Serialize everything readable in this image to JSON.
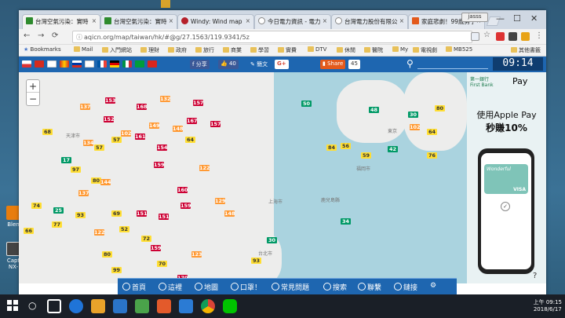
{
  "desktop": {
    "icons": [
      {
        "label": "Blen"
      },
      {
        "label": "Capt NX-"
      }
    ]
  },
  "browser": {
    "tabs": [
      {
        "label": "台灣空氣污染：實時",
        "color": "#2e8b2e"
      },
      {
        "label": "台灣空氣污染：實時",
        "color": "#2e8b2e"
      },
      {
        "label": "Windy: Wind map",
        "color": "#b5202a"
      },
      {
        "label": "今日電力資訊 - 電力",
        "color": "#888"
      },
      {
        "label": "台灣電力股份有限公",
        "color": "#888"
      },
      {
        "label": "家庭悲劇！99歲男子",
        "color": "#e35a1c"
      }
    ],
    "user_label": "jasss",
    "url": "aqicn.org/map/taiwan/hk/#@g/27.1563/119.9341/5z",
    "bookmarks": [
      "Bookmarks",
      "Mail",
      "入門網站",
      "理財",
      "政府",
      "旅行",
      "商業",
      "學習",
      "實費",
      "DTV",
      "休閒",
      "醫院",
      "My",
      "電視劇",
      "MB525"
    ],
    "other_bookmarks": "其他書籤"
  },
  "site": {
    "share_label": "分享",
    "like_count": "40",
    "chinese_label": "簡文",
    "gplus_label": "G+",
    "share_button": "Share",
    "share_count": "45",
    "time": "09:14"
  },
  "map": {
    "markers": [
      {
        "v": "137",
        "c": "#ff9933"
      },
      {
        "v": "153",
        "c": "#cc0033"
      },
      {
        "v": "168",
        "c": "#cc0033"
      },
      {
        "v": "132",
        "c": "#ff9933"
      },
      {
        "v": "157",
        "c": "#cc0033"
      },
      {
        "v": "68",
        "c": "#ffde33"
      },
      {
        "v": "134",
        "c": "#ff9933"
      },
      {
        "v": "152",
        "c": "#cc0033"
      },
      {
        "v": "149",
        "c": "#ff9933"
      },
      {
        "v": "148",
        "c": "#ff9933"
      },
      {
        "v": "57",
        "c": "#ffde33"
      },
      {
        "v": "102",
        "c": "#ff9933"
      },
      {
        "v": "161",
        "c": "#cc0033"
      },
      {
        "v": "154",
        "c": "#cc0033"
      },
      {
        "v": "64",
        "c": "#ffde33"
      },
      {
        "v": "57",
        "c": "#ffde33"
      },
      {
        "v": "167",
        "c": "#cc0033"
      },
      {
        "v": "157",
        "c": "#cc0033"
      },
      {
        "v": "17",
        "c": "#009966"
      },
      {
        "v": "97",
        "c": "#ffde33"
      },
      {
        "v": "80",
        "c": "#ffde33"
      },
      {
        "v": "137",
        "c": "#ff9933"
      },
      {
        "v": "159",
        "c": "#cc0033"
      },
      {
        "v": "144",
        "c": "#ff9933"
      },
      {
        "v": "160",
        "c": "#cc0033"
      },
      {
        "v": "122",
        "c": "#ff9933"
      },
      {
        "v": "74",
        "c": "#ffde33"
      },
      {
        "v": "25",
        "c": "#009966"
      },
      {
        "v": "93",
        "c": "#ffde33"
      },
      {
        "v": "151",
        "c": "#cc0033"
      },
      {
        "v": "69",
        "c": "#ffde33"
      },
      {
        "v": "151",
        "c": "#cc0033"
      },
      {
        "v": "159",
        "c": "#cc0033"
      },
      {
        "v": "129",
        "c": "#ff9933"
      },
      {
        "v": "148",
        "c": "#ff9933"
      },
      {
        "v": "66",
        "c": "#ffde33"
      },
      {
        "v": "77",
        "c": "#ffde33"
      },
      {
        "v": "122",
        "c": "#ff9933"
      },
      {
        "v": "52",
        "c": "#ffde33"
      },
      {
        "v": "72",
        "c": "#ffde33"
      },
      {
        "v": "159",
        "c": "#cc0033"
      },
      {
        "v": "80",
        "c": "#ffde33"
      },
      {
        "v": "70",
        "c": "#ffde33"
      },
      {
        "v": "123",
        "c": "#ff9933"
      },
      {
        "v": "99",
        "c": "#ffde33"
      },
      {
        "v": "170",
        "c": "#cc0033"
      },
      {
        "v": "50",
        "c": "#009966"
      },
      {
        "v": "84",
        "c": "#ffde33"
      },
      {
        "v": "48",
        "c": "#009966"
      },
      {
        "v": "30",
        "c": "#009966"
      },
      {
        "v": "56",
        "c": "#ffde33"
      },
      {
        "v": "102",
        "c": "#ff9933"
      },
      {
        "v": "59",
        "c": "#ffde33"
      },
      {
        "v": "42",
        "c": "#009966"
      },
      {
        "v": "64",
        "c": "#ffde33"
      },
      {
        "v": "76",
        "c": "#ffde33"
      },
      {
        "v": "80",
        "c": "#ffde33"
      },
      {
        "v": "34",
        "c": "#009966"
      },
      {
        "v": "30",
        "c": "#009966"
      },
      {
        "v": "93",
        "c": "#ffde33"
      }
    ],
    "labels": [
      "天津市",
      "東京",
      "福岡市",
      "長崎市",
      "鹿兒島縣",
      "上海市",
      "台北市"
    ],
    "zoom_in": "+",
    "zoom_out": "−"
  },
  "ad": {
    "bank": "第一銀行",
    "bank_en": "First Bank",
    "apple_pay": "Pay",
    "headline1": "使用Apple Pay",
    "headline2": "秒賺10%",
    "card_script": "Wonderful",
    "card_brand": "VISA"
  },
  "nav": [
    "首頁",
    "這裡",
    "地圖",
    "口罩！",
    "常見問題",
    "搜索",
    "聯繫",
    "鏈接"
  ],
  "taskbar": {
    "time": "上午 09:15",
    "date": "2018/6/17"
  }
}
